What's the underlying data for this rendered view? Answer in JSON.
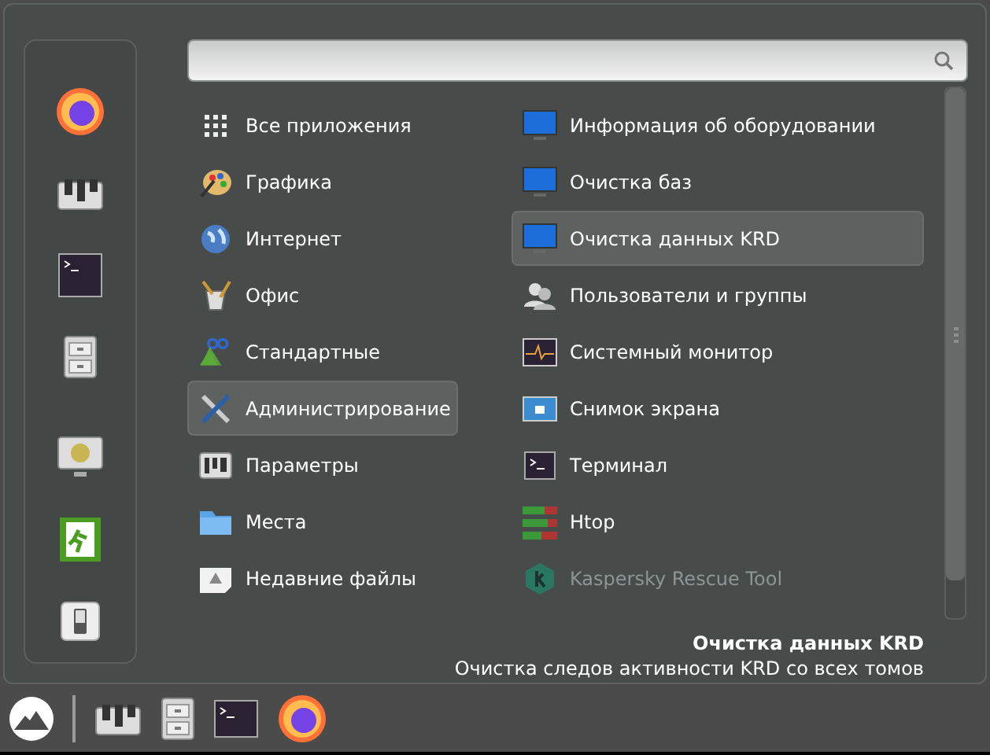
{
  "categories": [
    {
      "label": "Все приложения",
      "selected": false
    },
    {
      "label": "Графика",
      "selected": false
    },
    {
      "label": "Интернет",
      "selected": false
    },
    {
      "label": "Офис",
      "selected": false
    },
    {
      "label": "Стандартные",
      "selected": false
    },
    {
      "label": "Администрирование",
      "selected": true
    },
    {
      "label": "Параметры",
      "selected": false
    },
    {
      "label": "Места",
      "selected": false
    },
    {
      "label": "Недавние файлы",
      "selected": false
    }
  ],
  "apps": [
    {
      "label": "Информация об оборудовании",
      "selected": false,
      "dimmed": false
    },
    {
      "label": "Очистка баз",
      "selected": false,
      "dimmed": false
    },
    {
      "label": "Очистка данных KRD",
      "selected": true,
      "dimmed": false
    },
    {
      "label": "Пользователи и группы",
      "selected": false,
      "dimmed": false
    },
    {
      "label": "Системный монитор",
      "selected": false,
      "dimmed": false
    },
    {
      "label": "Снимок экрана",
      "selected": false,
      "dimmed": false
    },
    {
      "label": "Терминал",
      "selected": false,
      "dimmed": false
    },
    {
      "label": "Htop",
      "selected": false,
      "dimmed": false
    },
    {
      "label": "Kaspersky Rescue Tool",
      "selected": false,
      "dimmed": true
    }
  ],
  "description": {
    "title": "Очистка данных KRD",
    "text": "Очистка следов активности KRD со всех томов"
  }
}
